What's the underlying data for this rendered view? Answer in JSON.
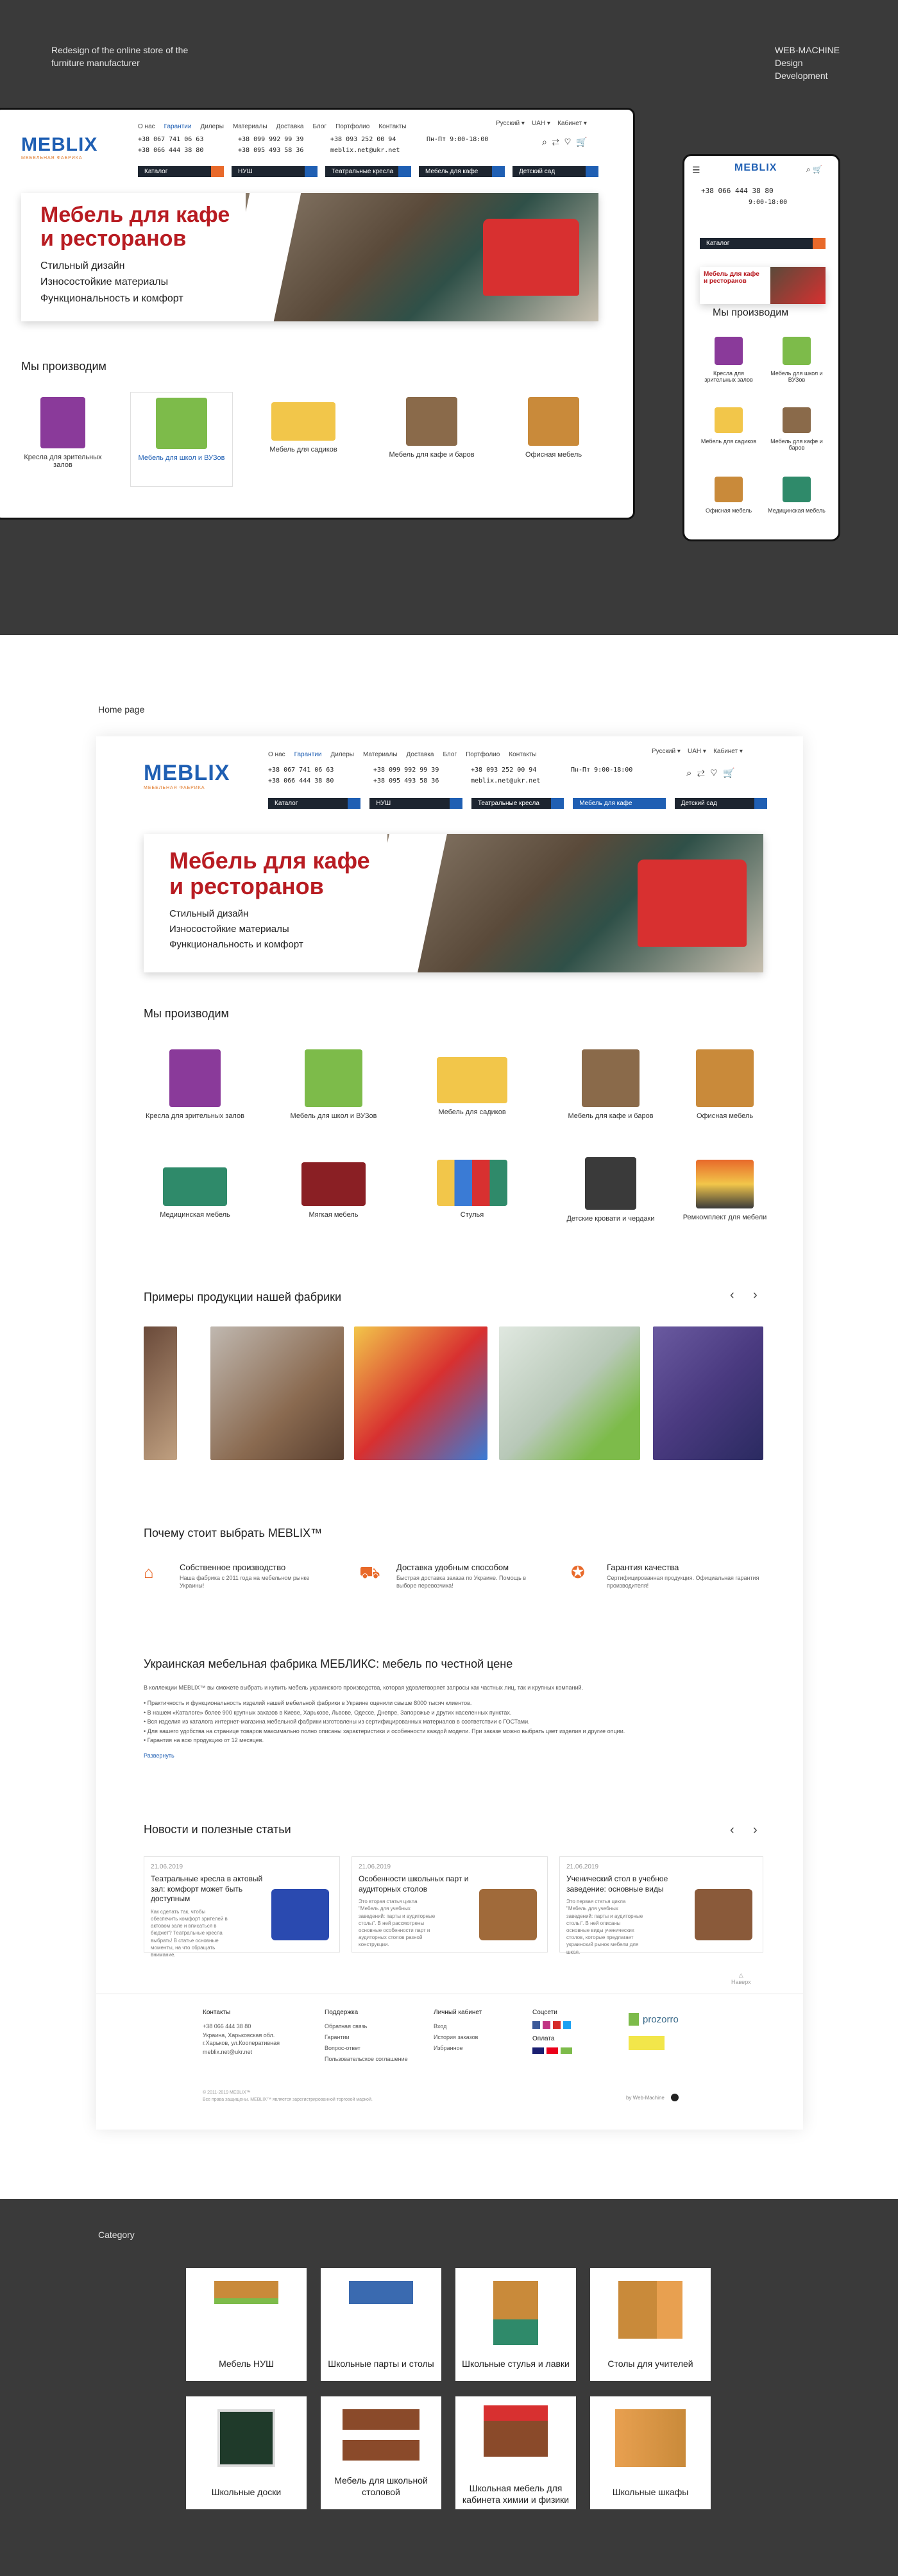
{
  "intro": {
    "left_line1": "Redesign of the online store of the",
    "left_line2": "furniture manufacturer",
    "right_line1": "WEB-MACHINE",
    "right_line2": "Design",
    "right_line3": "Development"
  },
  "brand": {
    "logo": "MEBLIX",
    "logo_sub": "МЕБЕЛЬНАЯ ФАБРИКА",
    "accent": "#1f5fb3",
    "orange": "#e8692a",
    "red": "#b81c22"
  },
  "nav": [
    "О нас",
    "Гарантии",
    "Дилеры",
    "Материалы",
    "Доставка",
    "Блог",
    "Портфолио",
    "Контакты"
  ],
  "lang": "Русский",
  "currency": "UAH",
  "cabinet": "Кабинет",
  "phones": {
    "p1": "+38 067 741 06 63",
    "p2": "+38 066 444 38 80",
    "p3": "+38 099 992 99 39",
    "p4": "+38 095 493 58 36",
    "p5": "+38 093 252 00 94",
    "email": "meblix.net@ukr.net",
    "hours": "Пн-Пт 9:00-18:00"
  },
  "catmenu": [
    "Каталог",
    "НУШ",
    "Театральные кресла",
    "Мебель для кафе",
    "Детский сад"
  ],
  "banner": {
    "title1": "Мебель для кафе",
    "title2": "и ресторанов",
    "f1": "Стильный дизайн",
    "f2": "Износостойкие материалы",
    "f3": "Функциональность и комфорт"
  },
  "we_produce": "Мы производим",
  "products": [
    "Кресла для зрительных залов",
    "Мебель для школ и ВУЗов",
    "Мебель для садиков",
    "Мебель для кафе и баров",
    "Офисная мебель",
    "Медицинская мебель",
    "Мягкая мебель",
    "Стулья",
    "Детские кровати и чердаки",
    "Ремкомплект для мебели"
  ],
  "mobile": {
    "phone": "+38 066 444 38 80",
    "hours": "9:00-18:00",
    "catalog": "Каталог",
    "banner_t1": "Мебель для кафе",
    "banner_t2": "и ресторанов",
    "we_produce": "Мы производим",
    "items": [
      "Кресла для зрительных залов",
      "Мебель для школ и ВУЗов",
      "Мебель для садиков",
      "Мебель для кафе и баров",
      "Офисная мебель",
      "Медицинская мебель"
    ]
  },
  "home_label": "Home page",
  "examples_title": "Примеры продукции нашей фабрики",
  "why_title": "Почему стоит выбрать MEBLIX™",
  "why": [
    {
      "t": "Собственное производство",
      "d": "Наша фабрика с 2011 года на мебельном рынке Украины!"
    },
    {
      "t": "Доставка удобным способом",
      "d": "Быстрая доставка заказа по Украине. Помощь в выборе перевозчика!"
    },
    {
      "t": "Гарантия качества",
      "d": "Сертифицированная продукция. Официальная гарантия производителя!"
    }
  ],
  "about": {
    "title": "Украинская мебельная фабрика МЕБЛИКС: мебель по честной цене",
    "p1": "В коллекции MEBLIX™ вы сможете выбрать и купить мебель украинского производства, которая удовлетворяет запросы как частных лиц, так и крупных компаний.",
    "b1": "• Практичность и функциональность изделий нашей мебельной фабрики в Украине оценили свыше 8000 тысяч клиентов.",
    "b2": "• В нашем «Каталоге» более 900 крупных заказов в Киеве, Харькове, Львове, Одессе, Днепре, Запорожье и других населенных пунктах.",
    "b3": "• Вся изделия из каталога интернет-магазина мебельной фабрики изготовлены из сертифицированных материалов в соответствии с ГОСТами.",
    "b4": "• Для вашего удобства на странице товаров максимально полно описаны характеристики и особенности каждой модели. При заказе можно выбрать цвет изделия и другие опции.",
    "b5": "• Гарантия на всю продукцию от 12 месяцев.",
    "more": "Развернуть"
  },
  "news_title": "Новости и полезные статьи",
  "news": [
    {
      "date": "21.06.2019",
      "t": "Театральные кресла в актовый зал: комфорт может быть доступным",
      "d": "Как сделать так, чтобы обеспечить комфорт зрителей в актовом зале и вписаться в бюджет? Театральные кресла выбрать! В статье основные моменты, на что обращать внимание."
    },
    {
      "date": "21.06.2019",
      "t": "Особенности школьных парт и аудиторных столов",
      "d": "Это вторая статья цикла \"Мебель для учебных заведений: парты и аудиторные столы\". В ней рассмотрены основные особенности парт и аудиторных столов разной конструкции."
    },
    {
      "date": "21.06.2019",
      "t": "Ученический стол в учебное заведение: основные виды",
      "d": "Это первая статья цикла \"Мебель для учебных заведений: парты и аудиторные столы\". В ней описаны основные виды ученических столов, которые предлагает украинский рынок мебели для школ."
    }
  ],
  "up": "Наверх",
  "footer": {
    "c1": "Контакты",
    "c1a": "+38 066 444 38 80",
    "c1b": "Украина, Харьковская обл. г.Харьков, ул.Кооперативная",
    "c1c": "meblix.net@ukr.net",
    "c2": "Поддержка",
    "c2a": "Обратная связь",
    "c2b": "Гарантии",
    "c2c": "Вопрос-ответ",
    "c2d": "Пользовательское соглашение",
    "c3": "Личный кабинет",
    "c3a": "Вход",
    "c3b": "История заказов",
    "c3c": "Избранное",
    "c4": "Соцсети",
    "c4b": "Оплата",
    "prozorro": "prozorro",
    "copy1": "© 2011-2019 MEBLIX™",
    "copy2": "Все права защищены. MEBLIX™ является зарегистрированной торговой маркой.",
    "made": "by Web-Machine"
  },
  "category_label": "Category",
  "categories": [
    "Мебель НУШ",
    "Школьные парты и столы",
    "Школьные стулья и лавки",
    "Столы для учителей",
    "Школьные доски",
    "Мебель для школьной столовой",
    "Школьная мебель для кабинета химии и физики",
    "Школьные шкафы"
  ]
}
